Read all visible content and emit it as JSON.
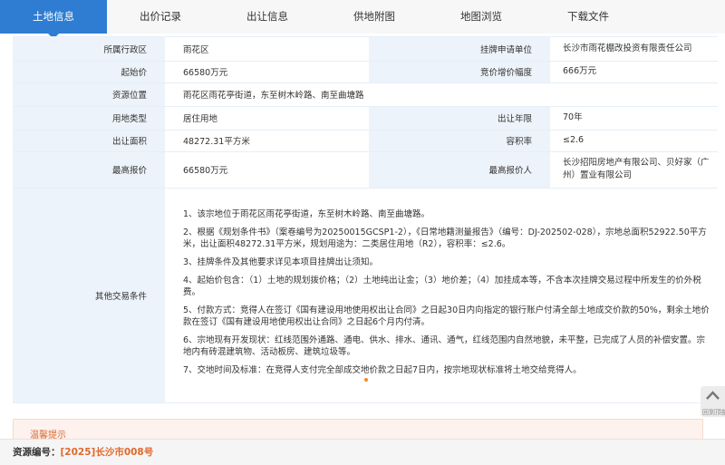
{
  "tabs": [
    "土地信息",
    "出价记录",
    "出让信息",
    "供地附图",
    "地图浏览",
    "下载文件"
  ],
  "info": {
    "district_label": "所属行政区",
    "district": "雨花区",
    "applicant_label": "挂牌申请单位",
    "applicant": "长沙市雨花棚改投资有限责任公司",
    "start_price_label": "起始价",
    "start_price": "66580万元",
    "increment_label": "竞价增价幅度",
    "increment": "666万元",
    "location_label": "资源位置",
    "location": "雨花区雨花亭街道，东至树木岭路、南至曲塘路",
    "use_label": "用地类型",
    "use": "居住用地",
    "years_label": "出让年限",
    "years": "70年",
    "area_label": "出让面积",
    "area": "48272.31平方米",
    "far_label": "容积率",
    "far": "≤2.6",
    "top_price_label": "最高报价",
    "top_price": "66580万元",
    "top_bidder_label": "最高报价人",
    "top_bidder": "长沙招阳房地产有限公司、贝好家（广州）置业有限公司",
    "terms_label": "其他交易条件",
    "terms": [
      "1、该宗地位于雨花区雨花亭街道，东至树木岭路、南至曲塘路。",
      "2、根据《规划条件书》（案卷编号为20250015GCSP1-2），《日常地籍测量报告》（编号：DJ-202502-028），宗地总面积52922.50平方米，出让面积48272.31平方米，规划用途为：二类居住用地（R2），容积率：≤2.6。",
      "3、挂牌条件及其他要求详见本项目挂牌出让须知。",
      "4、起始价包含：（1）土地的规划拨价格；（2）土地纯出让金；（3）地价差；（4）加挂成本等，不含本次挂牌交易过程中所发生的价外税费。",
      "5、付款方式：竞得人在签订《国有建设用地使用权出让合同》之日起30日内向指定的银行账户付清全部土地成交价款的50%，剩余土地价款在签订《国有建设用地使用权出让合同》之日起6个月内付清。",
      "6、宗地现有开发现状：红线范围外通路、通电、供水、排水、通讯、通气，红线范围内自然地貌，未平整，已完成了人员的补偿安置。宗地内有砖混建筑物、活动板房、建筑垃圾等。",
      "7、交地时间及标准：在竞得人支付完全部成交地价款之日起7日内，按宗地现状标准将土地交给竞得人。"
    ]
  },
  "notice": {
    "text": "温馨提示"
  },
  "footer": {
    "label": "资源编号：",
    "value": "[2025]长沙市008号"
  },
  "back_to_top": {
    "icon": "chevron-up-icon",
    "label": "回到顶部"
  },
  "colors": {
    "accent": "#2f7dd3",
    "label_bg": "#edf3fa",
    "highlight": "#e0682c"
  }
}
